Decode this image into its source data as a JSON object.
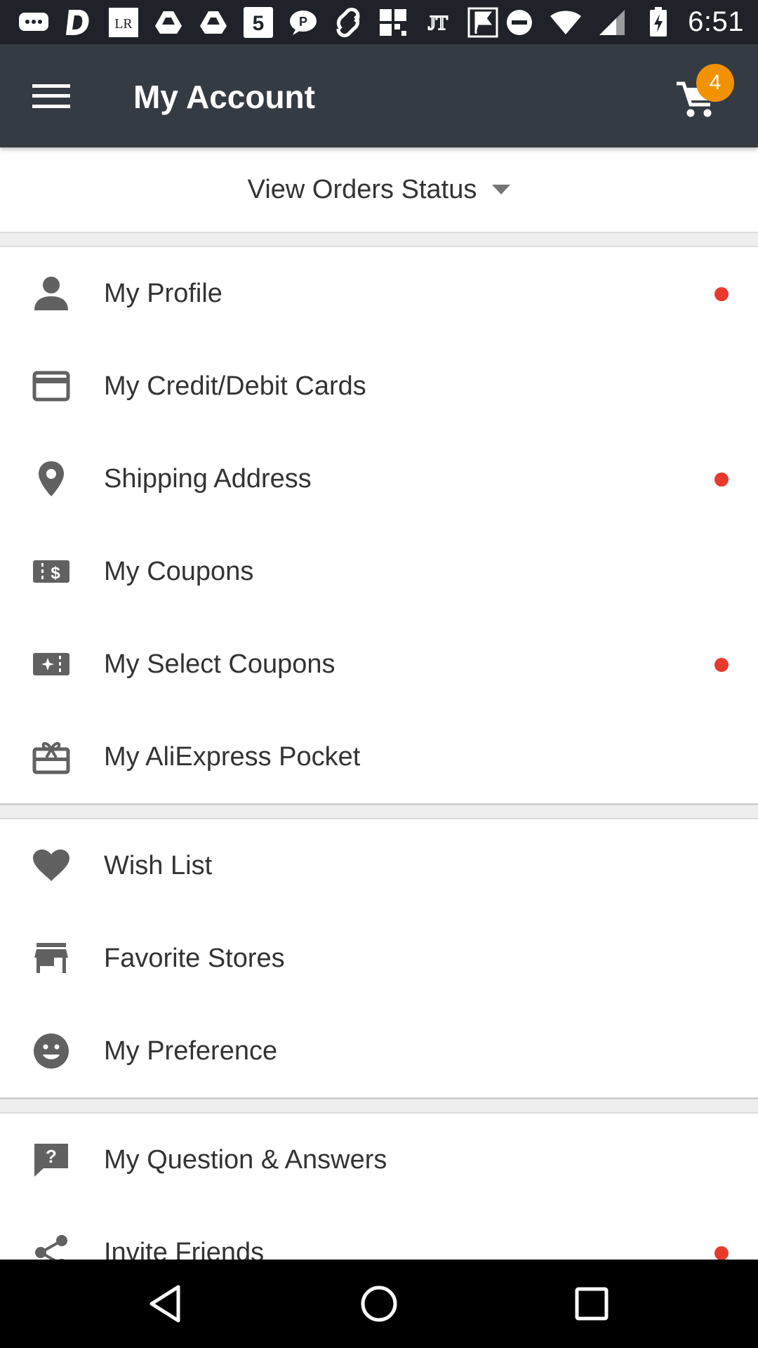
{
  "status_bar": {
    "time": "6:51",
    "notification_icons": [
      "chat-bubble-icon",
      "d-app-icon",
      "lr-app-icon",
      "drive-icon",
      "drive-icon",
      "five-app-icon",
      "pandora-icon",
      "link-app-icon",
      "grid-app-icon",
      "jt-app-icon",
      "flag-app-icon"
    ],
    "system_icons": [
      "do-not-disturb-icon",
      "wifi-icon",
      "signal-icon",
      "battery-charging-icon"
    ]
  },
  "app_bar": {
    "title": "My Account",
    "cart_count": "4",
    "colors": {
      "background": "#353b43",
      "badge": "#f39200"
    }
  },
  "orders_status": {
    "label": "View Orders Status"
  },
  "sections": [
    {
      "items": [
        {
          "label": "My Profile",
          "icon": "person-icon",
          "dot": true
        },
        {
          "label": "My Credit/Debit Cards",
          "icon": "credit-card-icon",
          "dot": false
        },
        {
          "label": "Shipping Address",
          "icon": "location-pin-icon",
          "dot": true
        },
        {
          "label": "My Coupons",
          "icon": "coupon-dollar-icon",
          "dot": false
        },
        {
          "label": "My Select Coupons",
          "icon": "coupon-star-icon",
          "dot": true
        },
        {
          "label": "My AliExpress Pocket",
          "icon": "gift-card-icon",
          "dot": false
        }
      ]
    },
    {
      "items": [
        {
          "label": "Wish List",
          "icon": "heart-icon",
          "dot": false
        },
        {
          "label": "Favorite Stores",
          "icon": "store-icon",
          "dot": false
        },
        {
          "label": "My Preference",
          "icon": "smiley-icon",
          "dot": false
        }
      ]
    },
    {
      "items": [
        {
          "label": "My Question & Answers",
          "icon": "question-bubble-icon",
          "dot": false
        },
        {
          "label": "Invite Friends",
          "icon": "share-icon",
          "dot": true
        }
      ]
    }
  ],
  "colors": {
    "notification_dot": "#e8392d",
    "icon": "#616161"
  },
  "nav_bar": {
    "buttons": [
      "back-icon",
      "home-icon",
      "recents-icon"
    ]
  }
}
